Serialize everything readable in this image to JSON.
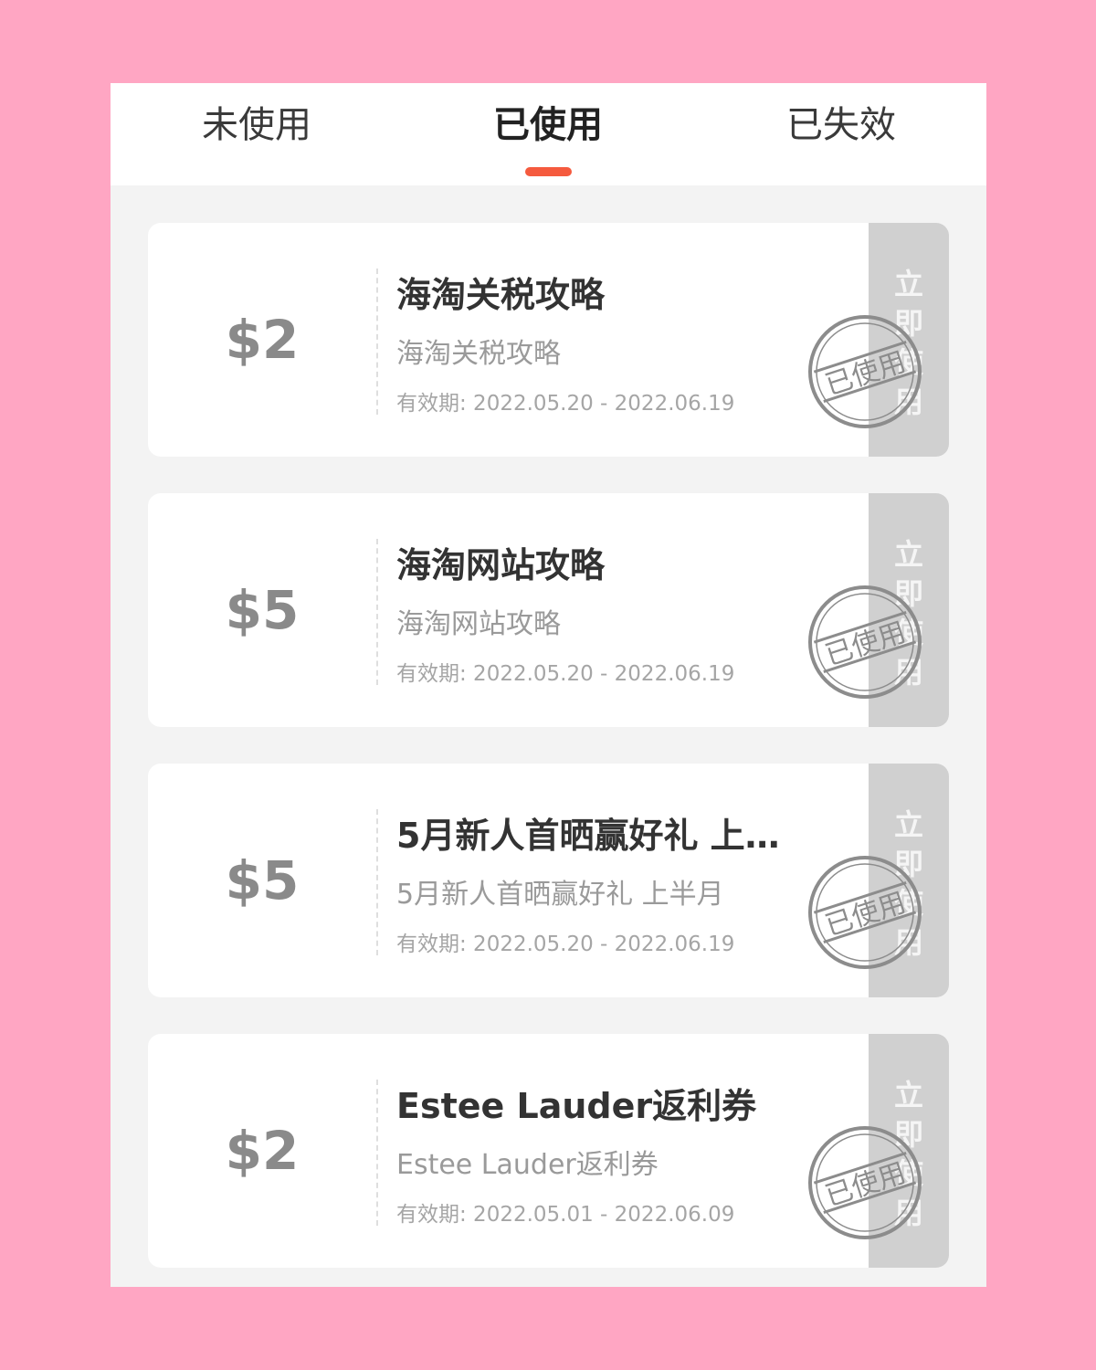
{
  "colors": {
    "background": "#ffa6c3",
    "accent": "#f55a3e",
    "stamp": "#8c8c8c"
  },
  "tabs": [
    {
      "label": "未使用",
      "active": false
    },
    {
      "label": "已使用",
      "active": true
    },
    {
      "label": "已失效",
      "active": false
    }
  ],
  "coupons": [
    {
      "amount": "$2",
      "title": "海淘关税攻略",
      "subtitle": "海淘关税攻略",
      "validity": "有效期: 2022.05.20 - 2022.06.19",
      "action_chars": [
        "立",
        "即",
        "使",
        "用"
      ],
      "stamp_text": "已使用"
    },
    {
      "amount": "$5",
      "title": "海淘网站攻略",
      "subtitle": "海淘网站攻略",
      "validity": "有效期: 2022.05.20 - 2022.06.19",
      "action_chars": [
        "立",
        "即",
        "使",
        "用"
      ],
      "stamp_text": "已使用"
    },
    {
      "amount": "$5",
      "title": "5月新人首晒赢好礼 上…",
      "subtitle": "5月新人首晒赢好礼 上半月",
      "validity": "有效期: 2022.05.20 - 2022.06.19",
      "action_chars": [
        "立",
        "即",
        "使",
        "用"
      ],
      "stamp_text": "已使用"
    },
    {
      "amount": "$2",
      "title": "Estee Lauder返利券",
      "subtitle": "Estee Lauder返利券",
      "validity": "有效期: 2022.05.01 - 2022.06.09",
      "action_chars": [
        "立",
        "即",
        "使",
        "用"
      ],
      "stamp_text": "已使用"
    }
  ]
}
